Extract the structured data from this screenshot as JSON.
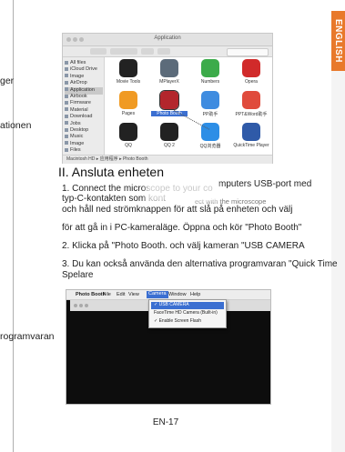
{
  "left_fragments": [
    "ger",
    "ationen",
    "rogramvaran"
  ],
  "side_tab": {
    "label": "ENGLISH",
    "color": "#e8792b"
  },
  "finder": {
    "window_title": "Application",
    "sidebar": [
      "All files",
      "iCloud Drive",
      "Image",
      "AirDrop",
      "Application",
      "Airbook",
      "Firmware",
      "Material",
      "Download",
      "Jobs",
      "Desktop",
      "Music",
      "Image",
      "Files"
    ],
    "selected_sidebar_index": 4,
    "apps": [
      {
        "label": "Movie Tools",
        "color": "#222222"
      },
      {
        "label": "MPlayerX",
        "color": "#5c6b7a"
      },
      {
        "label": "Numbers",
        "color": "#3cab4a"
      },
      {
        "label": "Opera",
        "color": "#d12a2a"
      },
      {
        "label": "Pages",
        "color": "#f09a23"
      },
      {
        "label": "Photo Booth",
        "color": "#b3262c"
      },
      {
        "label": "PP助手",
        "color": "#3f8ce0"
      },
      {
        "label": "PPT&Word助手",
        "color": "#e04b3c"
      },
      {
        "label": "QQ",
        "color": "#222222"
      },
      {
        "label": "QQ 2",
        "color": "#222222"
      },
      {
        "label": "QQ浏览器",
        "color": "#2d8ee6"
      },
      {
        "label": "QuickTime Player",
        "color": "#2f5aa8"
      }
    ],
    "selected_app_index": 5,
    "status": "Macintosh HD ▸ 应用程序 ▸ Photo Booth"
  },
  "section": {
    "heading": "II. Ansluta enheten",
    "lines": [
      "1. Connect the microscope to your co",
      "mputers USB-port med",
      "typ-C-kontakten som kont",
      "ect with the microscope",
      "och håll ned strömknappen för att slå på enheten och välj",
      "för att gå in i PC-kameraläge. Öppna och kör \"Photo Booth\"",
      "2. Klicka på \"Photo Booth. och välj kameran \"USB CAMERA",
      "3. Du kan också använda den alternativa programvaran \"Quick Time",
      "Spelare"
    ]
  },
  "photobooth": {
    "menu": [
      "Photo Booth",
      "File",
      "Edit",
      "View",
      "Camera",
      "Window",
      "Help"
    ],
    "active_menu_index": 4,
    "dropdown": [
      "✓ USB CAMERA",
      "FaceTime HD Camera (Built-in)",
      "✓ Enable Screen Flash"
    ]
  },
  "footer": "EN-17"
}
